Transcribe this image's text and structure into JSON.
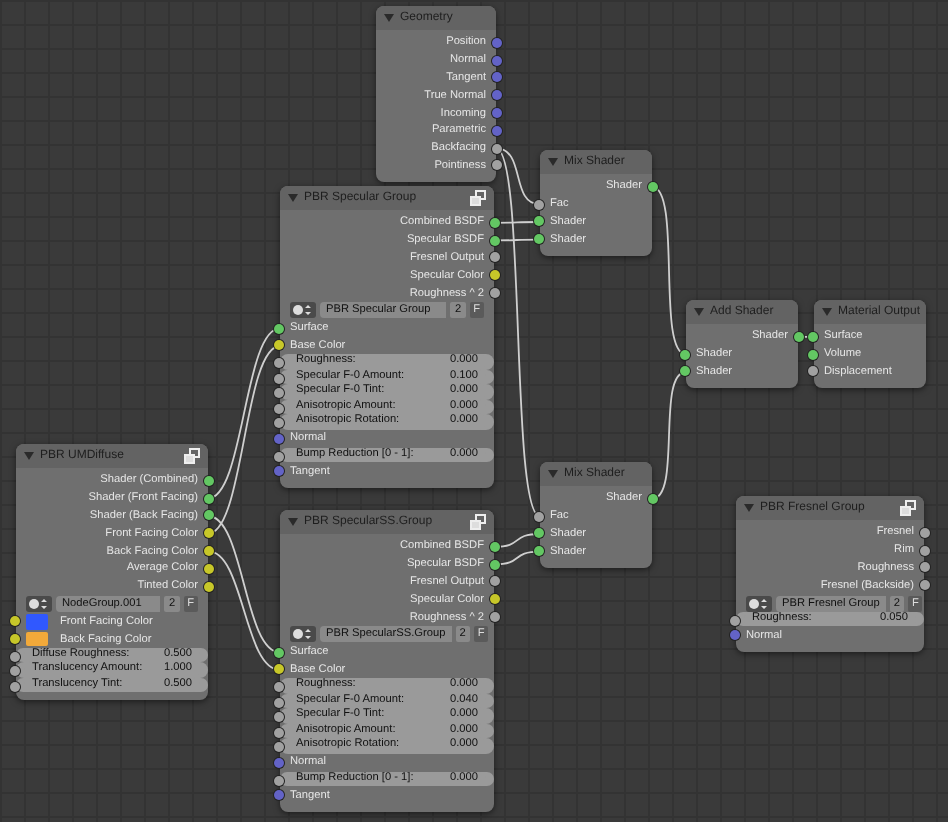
{
  "nodes": [
    {
      "title": "Geometry",
      "kind": "builtin",
      "rows": [
        {
          "kind": "output",
          "label": "Position",
          "socket": {
            "color": "#6363c7"
          }
        },
        {
          "kind": "output",
          "label": "Normal",
          "socket": {
            "color": "#6363c7"
          }
        },
        {
          "kind": "output",
          "label": "Tangent",
          "socket": {
            "color": "#6363c7"
          }
        },
        {
          "kind": "output",
          "label": "True Normal",
          "socket": {
            "color": "#6363c7"
          }
        },
        {
          "kind": "output",
          "label": "Incoming",
          "socket": {
            "color": "#6363c7"
          }
        },
        {
          "kind": "output",
          "label": "Parametric",
          "socket": {
            "color": "#6363c7"
          }
        },
        {
          "kind": "output",
          "label": "Backfacing",
          "socket": {
            "color": "#a1a1a1"
          }
        },
        {
          "kind": "output",
          "label": "Pointiness",
          "socket": {
            "color": "#a1a1a1"
          }
        }
      ]
    },
    {
      "title": "PBR Specular Group",
      "kind": "group",
      "rows": [
        {
          "kind": "output",
          "label": "Combined BSDF",
          "socket": {
            "color": "#63c763"
          }
        },
        {
          "kind": "output",
          "label": "Specular BSDF",
          "socket": {
            "color": "#63c763"
          }
        },
        {
          "kind": "output",
          "label": "Fresnel Output",
          "socket": {
            "color": "#a1a1a1"
          }
        },
        {
          "kind": "output",
          "label": "Specular Color",
          "socket": {
            "color": "#c7c729"
          }
        },
        {
          "kind": "output",
          "label": "Roughness ^ 2",
          "socket": {
            "color": "#a1a1a1"
          }
        },
        {
          "kind": "selector",
          "name": "PBR Specular Group",
          "users": "2",
          "fake_user": "F"
        },
        {
          "kind": "input",
          "label": "Surface",
          "socket": {
            "color": "#63c763"
          }
        },
        {
          "kind": "input",
          "label": "Base Color",
          "socket": {
            "color": "#c7c729"
          }
        },
        {
          "kind": "field",
          "label": "Roughness:",
          "value": "0.000",
          "socket": {
            "color": "#a1a1a1"
          }
        },
        {
          "kind": "field",
          "label": "Specular F-0 Amount:",
          "value": "0.100",
          "socket": {
            "color": "#a1a1a1"
          }
        },
        {
          "kind": "field",
          "label": "Specular F-0 Tint:",
          "value": "0.000",
          "socket": {
            "color": "#a1a1a1"
          }
        },
        {
          "kind": "field",
          "label": "Anisotropic Amount:",
          "value": "0.000",
          "socket": {
            "color": "#a1a1a1"
          }
        },
        {
          "kind": "field",
          "label": "Anisotropic Rotation:",
          "value": "0.000",
          "socket": {
            "color": "#a1a1a1"
          }
        },
        {
          "kind": "input",
          "label": "Normal",
          "socket": {
            "color": "#6363c7"
          }
        },
        {
          "kind": "field",
          "label": "Bump Reduction [0 - 1]:",
          "value": "0.000",
          "socket": {
            "color": "#a1a1a1"
          }
        },
        {
          "kind": "input",
          "label": "Tangent",
          "socket": {
            "color": "#6363c7"
          }
        }
      ]
    },
    {
      "title": "Mix Shader",
      "kind": "builtin",
      "rows": [
        {
          "kind": "output",
          "label": "Shader",
          "socket": {
            "color": "#63c763"
          }
        },
        {
          "kind": "input",
          "label": "Fac",
          "socket": {
            "color": "#a1a1a1"
          }
        },
        {
          "kind": "input",
          "label": "Shader",
          "socket": {
            "color": "#63c763"
          }
        },
        {
          "kind": "input",
          "label": "Shader",
          "socket": {
            "color": "#63c763"
          }
        }
      ]
    },
    {
      "title": "Add Shader",
      "kind": "builtin",
      "rows": [
        {
          "kind": "output",
          "label": "Shader",
          "socket": {
            "color": "#63c763"
          }
        },
        {
          "kind": "input",
          "label": "Shader",
          "socket": {
            "color": "#63c763"
          }
        },
        {
          "kind": "input",
          "label": "Shader",
          "socket": {
            "color": "#63c763"
          }
        }
      ]
    },
    {
      "title": "Material Output",
      "kind": "builtin",
      "rows": [
        {
          "kind": "input",
          "label": "Surface",
          "socket": {
            "color": "#63c763"
          }
        },
        {
          "kind": "input",
          "label": "Volume",
          "socket": {
            "color": "#63c763"
          }
        },
        {
          "kind": "input",
          "label": "Displacement",
          "socket": {
            "color": "#a1a1a1"
          }
        }
      ]
    },
    {
      "title": "PBR UMDiffuse",
      "kind": "group",
      "rows": [
        {
          "kind": "output",
          "label": "Shader (Combined)",
          "socket": {
            "color": "#63c763"
          }
        },
        {
          "kind": "output",
          "label": "Shader (Front Facing)",
          "socket": {
            "color": "#63c763"
          }
        },
        {
          "kind": "output",
          "label": "Shader (Back Facing)",
          "socket": {
            "color": "#63c763"
          }
        },
        {
          "kind": "output",
          "label": "Front Facing Color",
          "socket": {
            "color": "#c7c729"
          }
        },
        {
          "kind": "output",
          "label": "Back Facing Color",
          "socket": {
            "color": "#c7c729"
          }
        },
        {
          "kind": "output",
          "label": "Average Color",
          "socket": {
            "color": "#c7c729"
          }
        },
        {
          "kind": "output",
          "label": "Tinted Color",
          "socket": {
            "color": "#c7c729"
          }
        },
        {
          "kind": "selector",
          "name": "NodeGroup.001",
          "users": "2",
          "fake_user": "F"
        },
        {
          "kind": "color",
          "label": "Front Facing Color",
          "color": "#3058ff",
          "socket": {
            "color": "#c7c729"
          }
        },
        {
          "kind": "color",
          "label": "Back Facing Color",
          "color": "#f2a93a",
          "socket": {
            "color": "#c7c729"
          }
        },
        {
          "kind": "field",
          "label": "Diffuse Roughness:",
          "value": "0.500",
          "socket": {
            "color": "#a1a1a1"
          }
        },
        {
          "kind": "field",
          "label": "Translucency Amount:",
          "value": "1.000",
          "socket": {
            "color": "#a1a1a1"
          }
        },
        {
          "kind": "field",
          "label": "Translucency Tint:",
          "value": "0.500",
          "socket": {
            "color": "#a1a1a1"
          }
        }
      ]
    },
    {
      "title": "PBR SpecularSS.Group",
      "kind": "group",
      "rows": [
        {
          "kind": "output",
          "label": "Combined BSDF",
          "socket": {
            "color": "#63c763"
          }
        },
        {
          "kind": "output",
          "label": "Specular BSDF",
          "socket": {
            "color": "#63c763"
          }
        },
        {
          "kind": "output",
          "label": "Fresnel Output",
          "socket": {
            "color": "#a1a1a1"
          }
        },
        {
          "kind": "output",
          "label": "Specular Color",
          "socket": {
            "color": "#c7c729"
          }
        },
        {
          "kind": "output",
          "label": "Roughness ^ 2",
          "socket": {
            "color": "#a1a1a1"
          }
        },
        {
          "kind": "selector",
          "name": "PBR SpecularSS.Group",
          "users": "2",
          "fake_user": "F"
        },
        {
          "kind": "input",
          "label": "Surface",
          "socket": {
            "color": "#63c763"
          }
        },
        {
          "kind": "input",
          "label": "Base Color",
          "socket": {
            "color": "#c7c729"
          }
        },
        {
          "kind": "field",
          "label": "Roughness:",
          "value": "0.000",
          "socket": {
            "color": "#a1a1a1"
          }
        },
        {
          "kind": "field",
          "label": "Specular F-0 Amount:",
          "value": "0.040",
          "socket": {
            "color": "#a1a1a1"
          }
        },
        {
          "kind": "field",
          "label": "Specular F-0 Tint:",
          "value": "0.000",
          "socket": {
            "color": "#a1a1a1"
          }
        },
        {
          "kind": "field",
          "label": "Anisotropic Amount:",
          "value": "0.000",
          "socket": {
            "color": "#a1a1a1"
          }
        },
        {
          "kind": "field",
          "label": "Anisotropic Rotation:",
          "value": "0.000",
          "socket": {
            "color": "#a1a1a1"
          }
        },
        {
          "kind": "input",
          "label": "Normal",
          "socket": {
            "color": "#6363c7"
          }
        },
        {
          "kind": "field",
          "label": "Bump Reduction [0 - 1]:",
          "value": "0.000",
          "socket": {
            "color": "#a1a1a1"
          }
        },
        {
          "kind": "input",
          "label": "Tangent",
          "socket": {
            "color": "#6363c7"
          }
        }
      ]
    },
    {
      "title": "Mix Shader",
      "kind": "builtin",
      "rows": [
        {
          "kind": "output",
          "label": "Shader",
          "socket": {
            "color": "#63c763"
          }
        },
        {
          "kind": "input",
          "label": "Fac",
          "socket": {
            "color": "#a1a1a1"
          }
        },
        {
          "kind": "input",
          "label": "Shader",
          "socket": {
            "color": "#63c763"
          }
        },
        {
          "kind": "input",
          "label": "Shader",
          "socket": {
            "color": "#63c763"
          }
        }
      ]
    },
    {
      "title": "PBR Fresnel Group",
      "kind": "group",
      "rows": [
        {
          "kind": "output",
          "label": "Fresnel",
          "socket": {
            "color": "#a1a1a1"
          }
        },
        {
          "kind": "output",
          "label": "Rim",
          "socket": {
            "color": "#a1a1a1"
          }
        },
        {
          "kind": "output",
          "label": "Roughness",
          "socket": {
            "color": "#a1a1a1"
          }
        },
        {
          "kind": "output",
          "label": "Fresnel (Backside)",
          "socket": {
            "color": "#a1a1a1"
          }
        },
        {
          "kind": "selector",
          "name": "PBR Fresnel Group",
          "users": "2",
          "fake_user": "F"
        },
        {
          "kind": "field",
          "label": "Roughness:",
          "value": "0.050",
          "socket": {
            "color": "#a1a1a1"
          }
        },
        {
          "kind": "input",
          "label": "Normal",
          "socket": {
            "color": "#6363c7"
          }
        }
      ]
    }
  ]
}
